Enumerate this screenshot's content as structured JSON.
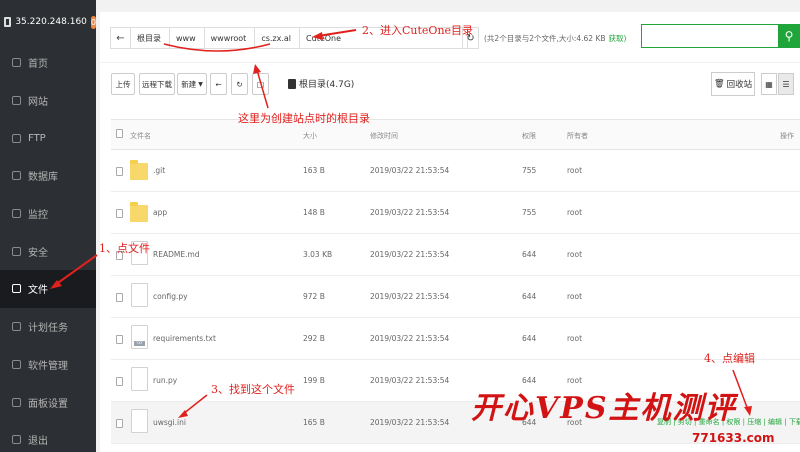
{
  "sidebar": {
    "host": "35.220.248.160",
    "badge": "0",
    "items": [
      {
        "label": "首页"
      },
      {
        "label": "网站"
      },
      {
        "label": "FTP"
      },
      {
        "label": "数据库"
      },
      {
        "label": "监控"
      },
      {
        "label": "安全"
      },
      {
        "label": "文件",
        "active": true
      },
      {
        "label": "计划任务"
      },
      {
        "label": "软件管理"
      },
      {
        "label": "面板设置"
      },
      {
        "label": "退出"
      }
    ]
  },
  "path": {
    "back_icon": "arrow-left-icon",
    "crumbs": [
      "根目录",
      "www",
      "wwwroot",
      "cs.zx.al",
      "CuteOne"
    ],
    "summary": "(共2个目录与2个文件,大小:4.62 KB",
    "summary_link": "获取)",
    "search_placeholder": ""
  },
  "toolbar": {
    "upload": "上传",
    "remote_download": "远程下载",
    "new": "新建",
    "disk": "根目录(4.7G)",
    "recycle": "回收站"
  },
  "table": {
    "headers": {
      "name": "文件名",
      "size": "大小",
      "mtime": "修改时间",
      "perm": "权限",
      "owner": "所有者",
      "ops": "操作"
    },
    "rows": [
      {
        "name": ".git",
        "size": "163 B",
        "mtime": "2019/03/22 21:53:54",
        "perm": "755",
        "owner": "root",
        "type": "folder"
      },
      {
        "name": "app",
        "size": "148 B",
        "mtime": "2019/03/22 21:53:54",
        "perm": "755",
        "owner": "root",
        "type": "folder"
      },
      {
        "name": "README.md",
        "size": "3.03 KB",
        "mtime": "2019/03/22 21:53:54",
        "perm": "644",
        "owner": "root",
        "type": "file"
      },
      {
        "name": "config.py",
        "size": "972 B",
        "mtime": "2019/03/22 21:53:54",
        "perm": "644",
        "owner": "root",
        "type": "file"
      },
      {
        "name": "requirements.txt",
        "size": "292 B",
        "mtime": "2019/03/22 21:53:54",
        "perm": "644",
        "owner": "root",
        "type": "txt"
      },
      {
        "name": "run.py",
        "size": "199 B",
        "mtime": "2019/03/22 21:53:54",
        "perm": "644",
        "owner": "root",
        "type": "file"
      },
      {
        "name": "uwsgi.ini",
        "size": "165 B",
        "mtime": "2019/03/22 21:53:54",
        "perm": "644",
        "owner": "root",
        "type": "file"
      }
    ],
    "row_ops": "复制 | 剪切 | 重命名 | 权限 | 压缩 | 编辑 | 下载 | 删除"
  },
  "annotations": {
    "step1": "1、点文件",
    "step2": "2、进入CuteOne目录",
    "step3": "3、找到这个文件",
    "step4": "4、点编辑",
    "root_note": "这里为创建站点时的根目录"
  },
  "watermark": {
    "text": "开心VPS主机测评",
    "url": "771633.com"
  }
}
